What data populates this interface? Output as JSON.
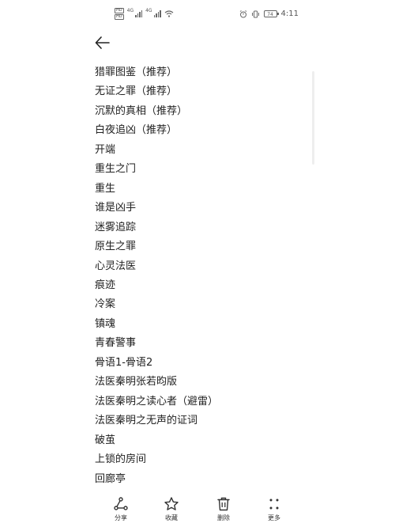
{
  "status_bar": {
    "sim1": "HD",
    "sim2": "HD",
    "net1": "4G",
    "net2": "4G",
    "battery": "74",
    "time": "4:11"
  },
  "notes": [
    "猎罪图鉴（推荐）",
    "无证之罪（推荐）",
    "沉默的真相（推荐）",
    "白夜追凶（推荐）",
    "开端",
    "重生之门",
    "重生",
    "谁是凶手",
    "迷雾追踪",
    "原生之罪",
    "心灵法医",
    "痕迹",
    "冷案",
    "镇魂",
    "青春警事",
    "骨语1-骨语2",
    "法医秦明张若昀版",
    "法医秦明之读心者（避雷）",
    "法医秦明之无声的证词",
    "破茧",
    "上锁的房间",
    "回廊亭"
  ],
  "toolbar": {
    "share": "分享",
    "favorite": "收藏",
    "delete": "删除",
    "more": "更多"
  }
}
